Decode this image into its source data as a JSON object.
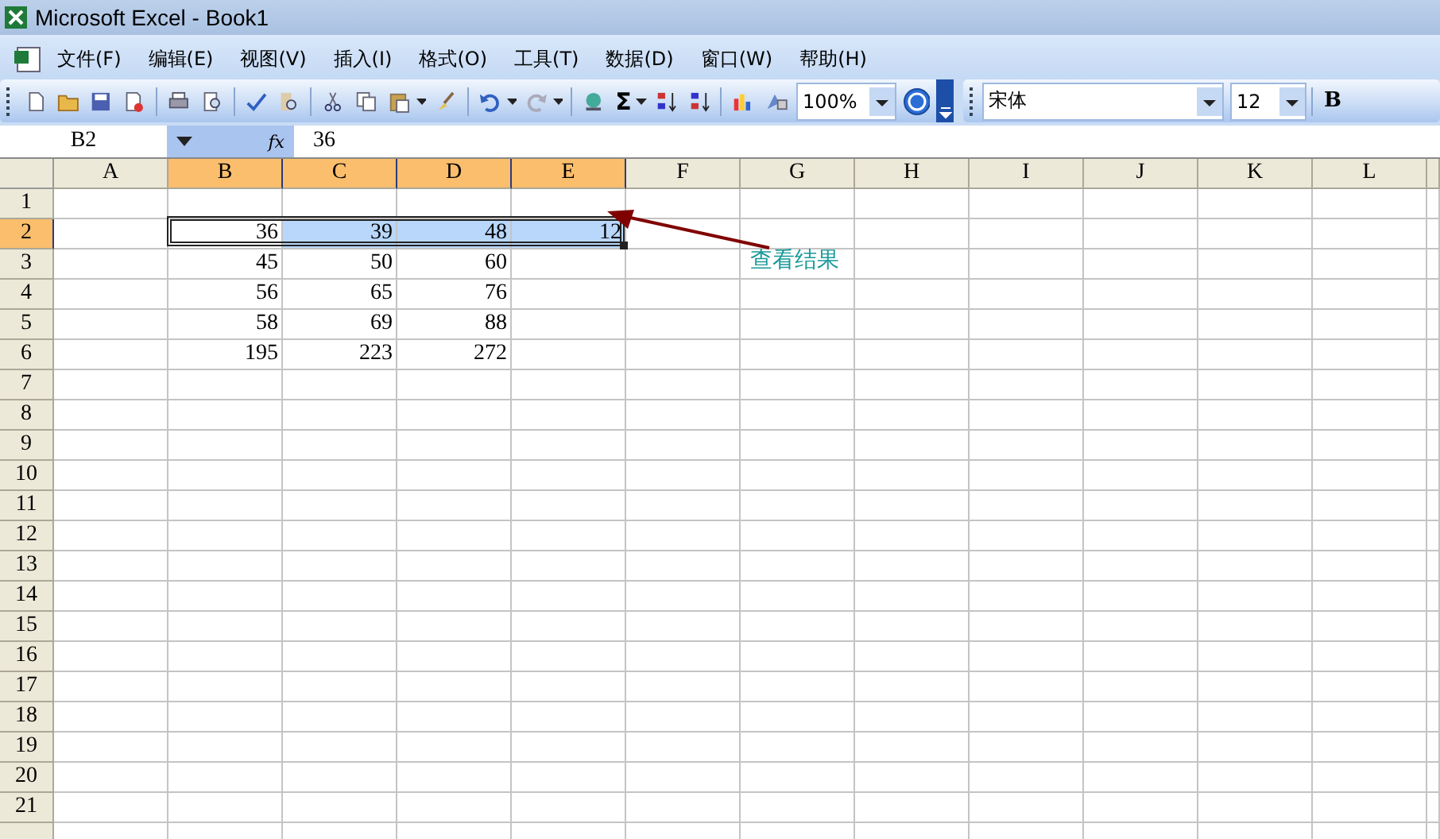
{
  "window": {
    "title": "Microsoft Excel - Book1"
  },
  "menu": [
    "文件(F)",
    "编辑(E)",
    "视图(V)",
    "插入(I)",
    "格式(O)",
    "工具(T)",
    "数据(D)",
    "窗口(W)",
    "帮助(H)"
  ],
  "toolbar": {
    "sum_symbol": "Σ",
    "zoom": "100%",
    "font": "宋体",
    "font_size": "12",
    "bold_label": "B"
  },
  "formula_bar": {
    "name_box": "B2",
    "fx_label": "fx",
    "value": "36"
  },
  "columns": [
    {
      "label": "A",
      "selected": false
    },
    {
      "label": "B",
      "selected": true
    },
    {
      "label": "C",
      "selected": true
    },
    {
      "label": "D",
      "selected": true
    },
    {
      "label": "E",
      "selected": true
    },
    {
      "label": "F",
      "selected": false
    },
    {
      "label": "G",
      "selected": false
    },
    {
      "label": "H",
      "selected": false
    },
    {
      "label": "I",
      "selected": false
    },
    {
      "label": "J",
      "selected": false
    },
    {
      "label": "K",
      "selected": false
    },
    {
      "label": "L",
      "selected": false
    }
  ],
  "rows": [
    {
      "label": "1",
      "selected": false
    },
    {
      "label": "2",
      "selected": true,
      "cells": [
        {
          "selected": false
        },
        {
          "text": "36",
          "selected": true,
          "active": true
        },
        {
          "text": "39",
          "selected": true
        },
        {
          "text": "48",
          "selected": true
        },
        {
          "text": "12",
          "selected": true
        },
        {
          "selected": false
        },
        {
          "selected": false
        },
        {
          "selected": false
        },
        {
          "selected": false
        },
        {
          "selected": false
        },
        {
          "selected": false
        },
        {
          "selected": false
        }
      ]
    },
    {
      "label": "3",
      "selected": false,
      "cells": [
        {
          "selected": false
        },
        {
          "text": "45",
          "selected": false
        },
        {
          "text": "50",
          "selected": false
        },
        {
          "text": "60",
          "selected": false
        },
        {
          "selected": false
        },
        {
          "selected": false
        },
        {
          "selected": false
        },
        {
          "selected": false
        },
        {
          "selected": false
        },
        {
          "selected": false
        },
        {
          "selected": false
        },
        {
          "selected": false
        }
      ]
    },
    {
      "label": "4",
      "selected": false,
      "cells": [
        {
          "selected": false
        },
        {
          "text": "56",
          "selected": false
        },
        {
          "text": "65",
          "selected": false
        },
        {
          "text": "76",
          "selected": false
        },
        {
          "selected": false
        },
        {
          "selected": false
        },
        {
          "selected": false
        },
        {
          "selected": false
        },
        {
          "selected": false
        },
        {
          "selected": false
        },
        {
          "selected": false
        },
        {
          "selected": false
        }
      ]
    },
    {
      "label": "5",
      "selected": false,
      "cells": [
        {
          "selected": false
        },
        {
          "text": "58",
          "selected": false
        },
        {
          "text": "69",
          "selected": false
        },
        {
          "text": "88",
          "selected": false
        },
        {
          "selected": false
        },
        {
          "selected": false
        },
        {
          "selected": false
        },
        {
          "selected": false
        },
        {
          "selected": false
        },
        {
          "selected": false
        },
        {
          "selected": false
        },
        {
          "selected": false
        }
      ]
    },
    {
      "label": "6",
      "selected": false,
      "cells": [
        {
          "selected": false
        },
        {
          "text": "195",
          "selected": false
        },
        {
          "text": "223",
          "selected": false
        },
        {
          "text": "272",
          "selected": false
        },
        {
          "selected": false
        },
        {
          "selected": false
        },
        {
          "selected": false
        },
        {
          "selected": false
        },
        {
          "selected": false
        },
        {
          "selected": false
        },
        {
          "selected": false
        },
        {
          "selected": false
        }
      ]
    },
    {
      "label": "7",
      "selected": false
    },
    {
      "label": "8",
      "selected": false
    },
    {
      "label": "9",
      "selected": false
    },
    {
      "label": "10",
      "selected": false
    },
    {
      "label": "11",
      "selected": false
    },
    {
      "label": "12",
      "selected": false
    },
    {
      "label": "13",
      "selected": false
    },
    {
      "label": "14",
      "selected": false
    },
    {
      "label": "15",
      "selected": false
    },
    {
      "label": "16",
      "selected": false
    },
    {
      "label": "17",
      "selected": false
    },
    {
      "label": "18",
      "selected": false
    },
    {
      "label": "19",
      "selected": false
    },
    {
      "label": "20",
      "selected": false
    },
    {
      "label": "21",
      "selected": false
    }
  ],
  "annotation": {
    "text": "查看结果"
  }
}
